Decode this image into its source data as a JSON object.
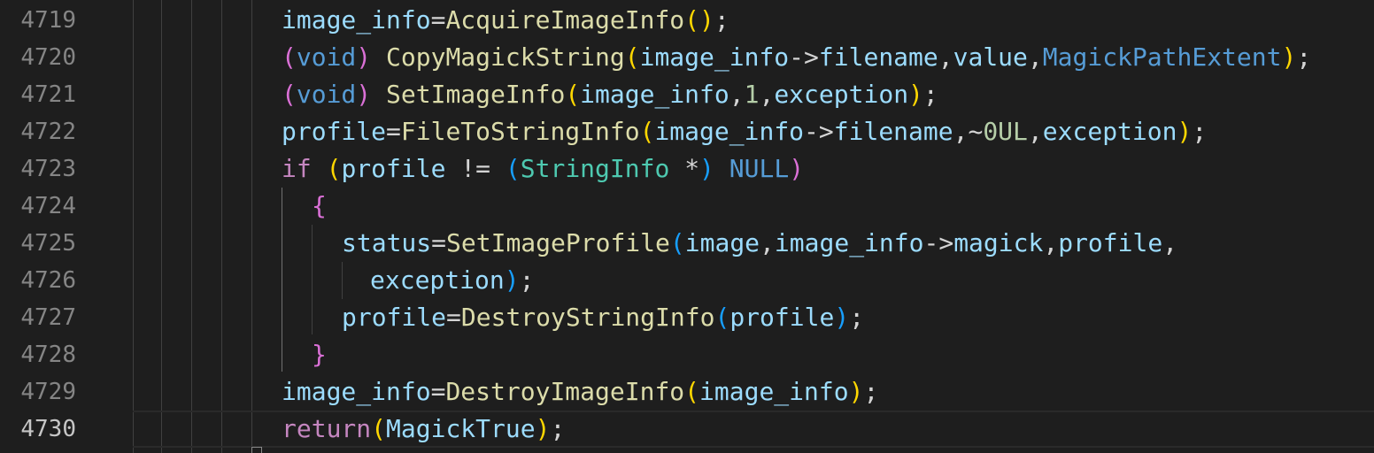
{
  "editor": {
    "current_line": "4730",
    "lines": [
      {
        "number": "4719",
        "indent": 1,
        "tokens": [
          {
            "t": "image_info",
            "c": "var"
          },
          {
            "t": "=",
            "c": "op"
          },
          {
            "t": "AcquireImageInfo",
            "c": "fn"
          },
          {
            "t": "()",
            "c": "p1"
          },
          {
            "t": ";",
            "c": "op"
          }
        ]
      },
      {
        "number": "4720",
        "indent": 1,
        "tokens": [
          {
            "t": "(",
            "c": "p2"
          },
          {
            "t": "void",
            "c": "type"
          },
          {
            "t": ")",
            "c": "p2"
          },
          {
            "t": " ",
            "c": "op"
          },
          {
            "t": "CopyMagickString",
            "c": "fn"
          },
          {
            "t": "(",
            "c": "p1"
          },
          {
            "t": "image_info",
            "c": "var"
          },
          {
            "t": "->",
            "c": "op"
          },
          {
            "t": "filename",
            "c": "var"
          },
          {
            "t": ",",
            "c": "op"
          },
          {
            "t": "value",
            "c": "var"
          },
          {
            "t": ",",
            "c": "op"
          },
          {
            "t": "MagickPathExtent",
            "c": "type"
          },
          {
            "t": ")",
            "c": "p1"
          },
          {
            "t": ";",
            "c": "op"
          }
        ]
      },
      {
        "number": "4721",
        "indent": 1,
        "tokens": [
          {
            "t": "(",
            "c": "p2"
          },
          {
            "t": "void",
            "c": "type"
          },
          {
            "t": ")",
            "c": "p2"
          },
          {
            "t": " ",
            "c": "op"
          },
          {
            "t": "SetImageInfo",
            "c": "fn"
          },
          {
            "t": "(",
            "c": "p1"
          },
          {
            "t": "image_info",
            "c": "var"
          },
          {
            "t": ",",
            "c": "op"
          },
          {
            "t": "1",
            "c": "num"
          },
          {
            "t": ",",
            "c": "op"
          },
          {
            "t": "exception",
            "c": "var"
          },
          {
            "t": ")",
            "c": "p1"
          },
          {
            "t": ";",
            "c": "op"
          }
        ]
      },
      {
        "number": "4722",
        "indent": 1,
        "tokens": [
          {
            "t": "profile",
            "c": "var"
          },
          {
            "t": "=",
            "c": "op"
          },
          {
            "t": "FileToStringInfo",
            "c": "fn"
          },
          {
            "t": "(",
            "c": "p1"
          },
          {
            "t": "image_info",
            "c": "var"
          },
          {
            "t": "->",
            "c": "op"
          },
          {
            "t": "filename",
            "c": "var"
          },
          {
            "t": ",",
            "c": "op"
          },
          {
            "t": "~",
            "c": "op"
          },
          {
            "t": "0UL",
            "c": "num"
          },
          {
            "t": ",",
            "c": "op"
          },
          {
            "t": "exception",
            "c": "var"
          },
          {
            "t": ")",
            "c": "p1"
          },
          {
            "t": ";",
            "c": "op"
          }
        ]
      },
      {
        "number": "4723",
        "indent": 1,
        "tokens": [
          {
            "t": "if",
            "c": "kw"
          },
          {
            "t": " ",
            "c": "op"
          },
          {
            "t": "(",
            "c": "p1"
          },
          {
            "t": "profile",
            "c": "var"
          },
          {
            "t": " != ",
            "c": "op"
          },
          {
            "t": "(",
            "c": "p3"
          },
          {
            "t": "StringInfo",
            "c": "cls"
          },
          {
            "t": " ",
            "c": "op"
          },
          {
            "t": "*",
            "c": "op"
          },
          {
            "t": ")",
            "c": "p3"
          },
          {
            "t": " ",
            "c": "op"
          },
          {
            "t": "NULL",
            "c": "type"
          },
          {
            "t": ")",
            "c": "p2"
          }
        ]
      },
      {
        "number": "4724",
        "indent": 2,
        "tokens": [
          {
            "t": "{",
            "c": "p2"
          }
        ]
      },
      {
        "number": "4725",
        "indent": 3,
        "tokens": [
          {
            "t": "status",
            "c": "var"
          },
          {
            "t": "=",
            "c": "op"
          },
          {
            "t": "SetImageProfile",
            "c": "fn"
          },
          {
            "t": "(",
            "c": "p3"
          },
          {
            "t": "image",
            "c": "var"
          },
          {
            "t": ",",
            "c": "op"
          },
          {
            "t": "image_info",
            "c": "var"
          },
          {
            "t": "->",
            "c": "op"
          },
          {
            "t": "magick",
            "c": "var"
          },
          {
            "t": ",",
            "c": "op"
          },
          {
            "t": "profile",
            "c": "var"
          },
          {
            "t": ",",
            "c": "op"
          }
        ]
      },
      {
        "number": "4726",
        "indent": 4,
        "tokens": [
          {
            "t": "exception",
            "c": "var"
          },
          {
            "t": ")",
            "c": "p3"
          },
          {
            "t": ";",
            "c": "op"
          }
        ]
      },
      {
        "number": "4727",
        "indent": 3,
        "tokens": [
          {
            "t": "profile",
            "c": "var"
          },
          {
            "t": "=",
            "c": "op"
          },
          {
            "t": "DestroyStringInfo",
            "c": "fn"
          },
          {
            "t": "(",
            "c": "p3"
          },
          {
            "t": "profile",
            "c": "var"
          },
          {
            "t": ")",
            "c": "p3"
          },
          {
            "t": ";",
            "c": "op"
          }
        ]
      },
      {
        "number": "4728",
        "indent": 2,
        "tokens": [
          {
            "t": "}",
            "c": "p2"
          }
        ]
      },
      {
        "number": "4729",
        "indent": 1,
        "tokens": [
          {
            "t": "image_info",
            "c": "var"
          },
          {
            "t": "=",
            "c": "op"
          },
          {
            "t": "DestroyImageInfo",
            "c": "fn"
          },
          {
            "t": "(",
            "c": "p1"
          },
          {
            "t": "image_info",
            "c": "var"
          },
          {
            "t": ")",
            "c": "p1"
          },
          {
            "t": ";",
            "c": "op"
          }
        ]
      },
      {
        "number": "4730",
        "indent": 1,
        "tokens": [
          {
            "t": "return",
            "c": "kw"
          },
          {
            "t": "(",
            "c": "p1"
          },
          {
            "t": "MagickTrue",
            "c": "var"
          },
          {
            "t": ")",
            "c": "p1"
          },
          {
            "t": ";",
            "c": "op"
          }
        ]
      }
    ]
  }
}
